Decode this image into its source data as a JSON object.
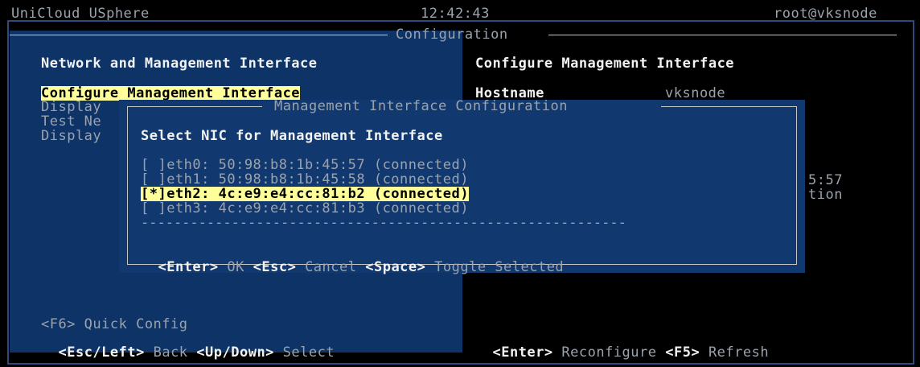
{
  "header": {
    "app_name": "UniCloud USphere",
    "time": "12:42:43",
    "user": "root@vksnode",
    "section_title": "Configuration"
  },
  "left_panel": {
    "title": "Network and Management Interface",
    "menu": [
      "Configure Management Interface",
      "Display",
      "Test Ne",
      "Display"
    ],
    "footer_line1": "<F6> Quick Config",
    "footer_keys": {
      "back_key": "<Esc/Left>",
      "back_label": "Back",
      "select_key": "<Up/Down>",
      "select_label": "Select"
    }
  },
  "right_panel": {
    "title": "Configure Management Interface",
    "hostname_label": "Hostname",
    "hostname_value": "vksnode",
    "partial_1": "5:57",
    "partial_2": "tion",
    "footer_keys": {
      "reconfigure_key": "<Enter>",
      "reconfigure_label": "Reconfigure",
      "refresh_key": "<F5>",
      "refresh_label": "Refresh"
    }
  },
  "dialog": {
    "title": "Management Interface Configuration",
    "prompt": "Select NIC for Management Interface",
    "nics": [
      {
        "text": "[ ]eth0: 50:98:b8:1b:45:57 (connected)",
        "selected": false
      },
      {
        "text": "[ ]eth1: 50:98:b8:1b:45:58 (connected)",
        "selected": false
      },
      {
        "text": "[*]eth2: 4c:e9:e4:cc:81:b2 (connected)",
        "selected": true
      },
      {
        "text": "[ ]eth3: 4c:e9:e4:cc:81:b3 (connected)",
        "selected": false
      }
    ],
    "separator": "-----------------------------------------------------------",
    "keys": {
      "ok_key": "<Enter>",
      "ok_label": "OK",
      "cancel_key": "<Esc>",
      "cancel_label": "Cancel",
      "toggle_key": "<Space>",
      "toggle_label": "Toggle Selected"
    }
  },
  "colors": {
    "panel_blue": "#0e3366",
    "dialog_blue": "#12396f",
    "highlight": "#ffff99"
  }
}
